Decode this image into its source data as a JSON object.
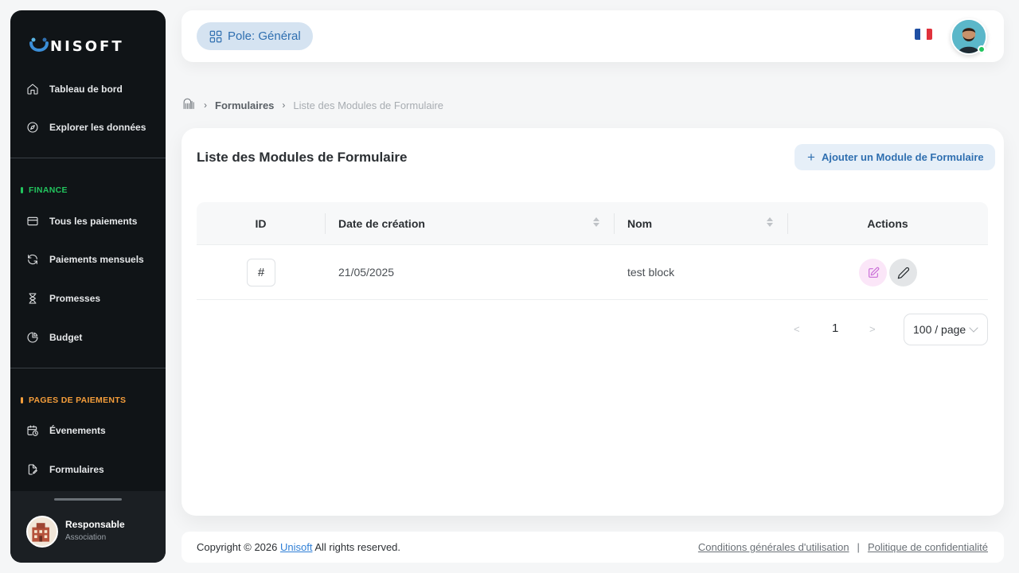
{
  "brand": {
    "name": "NISOFT",
    "colors": {
      "primary": "#2f6fb0",
      "accent_green": "#22c55e",
      "accent_orange": "#f59e3b",
      "sidebar_bg": "#101417"
    }
  },
  "sidebar": {
    "top_items": [
      {
        "label": "Tableau de bord",
        "icon": "home-icon"
      },
      {
        "label": "Explorer les données",
        "icon": "compass-icon"
      }
    ],
    "sections": [
      {
        "title": "FINANCE",
        "color": "#22c55e",
        "items": [
          {
            "label": "Tous les paiements",
            "icon": "credit-card-icon"
          },
          {
            "label": "Paiements mensuels",
            "icon": "refresh-icon"
          },
          {
            "label": "Promesses",
            "icon": "hourglass-icon"
          },
          {
            "label": "Budget",
            "icon": "pie-chart-icon"
          }
        ]
      },
      {
        "title": "PAGES DE PAIEMENTS",
        "color": "#f59e3b",
        "items": [
          {
            "label": "Évenements",
            "icon": "calendar-clock-icon"
          },
          {
            "label": "Formulaires",
            "icon": "file-edit-icon"
          }
        ]
      }
    ],
    "user": {
      "role": "Responsable",
      "subtitle": "Association"
    }
  },
  "header": {
    "pole_label": "Pole: Général",
    "language": "fr"
  },
  "breadcrumb": {
    "link": "Formulaires",
    "current": "Liste des Modules de Formulaire"
  },
  "card": {
    "title": "Liste des Modules de Formulaire",
    "add_button": "Ajouter un Module de Formulaire"
  },
  "table": {
    "columns": {
      "id": "ID",
      "date": "Date de création",
      "name": "Nom",
      "actions": "Actions"
    },
    "rows": [
      {
        "id_symbol": "#",
        "date": "21/05/2025",
        "name": "test block"
      }
    ]
  },
  "pagination": {
    "prev": "<",
    "current_page": "1",
    "next": ">",
    "page_size": "100 / page"
  },
  "footer": {
    "copyright_prefix": "Copyright © 2026",
    "company": "Unisoft",
    "copyright_suffix": "All rights reserved.",
    "terms": "Conditions générales d'utilisation",
    "separator": "|",
    "privacy": "Politique de confidentialité"
  }
}
